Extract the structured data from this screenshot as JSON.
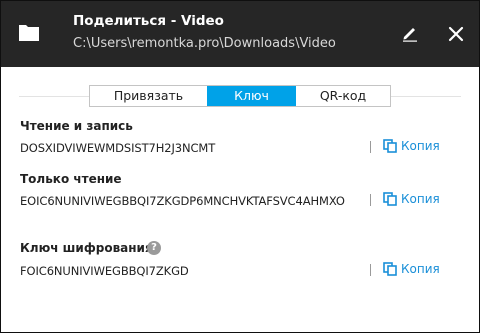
{
  "header": {
    "title": "Поделиться - Video",
    "path": "C:\\Users\\remontka.pro\\Downloads\\Video",
    "folder_icon": "folder-icon",
    "edit_icon": "pencil-icon",
    "close_icon": "close-icon"
  },
  "tabs": [
    {
      "label": "Привязать",
      "active": false
    },
    {
      "label": "Ключ",
      "active": true
    },
    {
      "label": "QR-код",
      "active": false
    }
  ],
  "sections": {
    "readwrite": {
      "label": "Чтение и запись",
      "value": "DOSXIDVIWEWMDSIST7H2J3NCMT",
      "copy_label": "Копия"
    },
    "readonly": {
      "label": "Только чтение",
      "value": "EOIC6NUNIVIWEGBBQI7ZKGDP6MNCHVKTAFSVC4AHMXO",
      "copy_label": "Копия"
    },
    "encryption": {
      "label": "Ключ шифрования",
      "help": "?",
      "value": "FOIC6NUNIVIWEGBBQI7ZKGD",
      "copy_label": "Копия"
    }
  },
  "colors": {
    "header_bg": "#262626",
    "accent": "#00a2e8",
    "link": "#1a8fd8"
  }
}
